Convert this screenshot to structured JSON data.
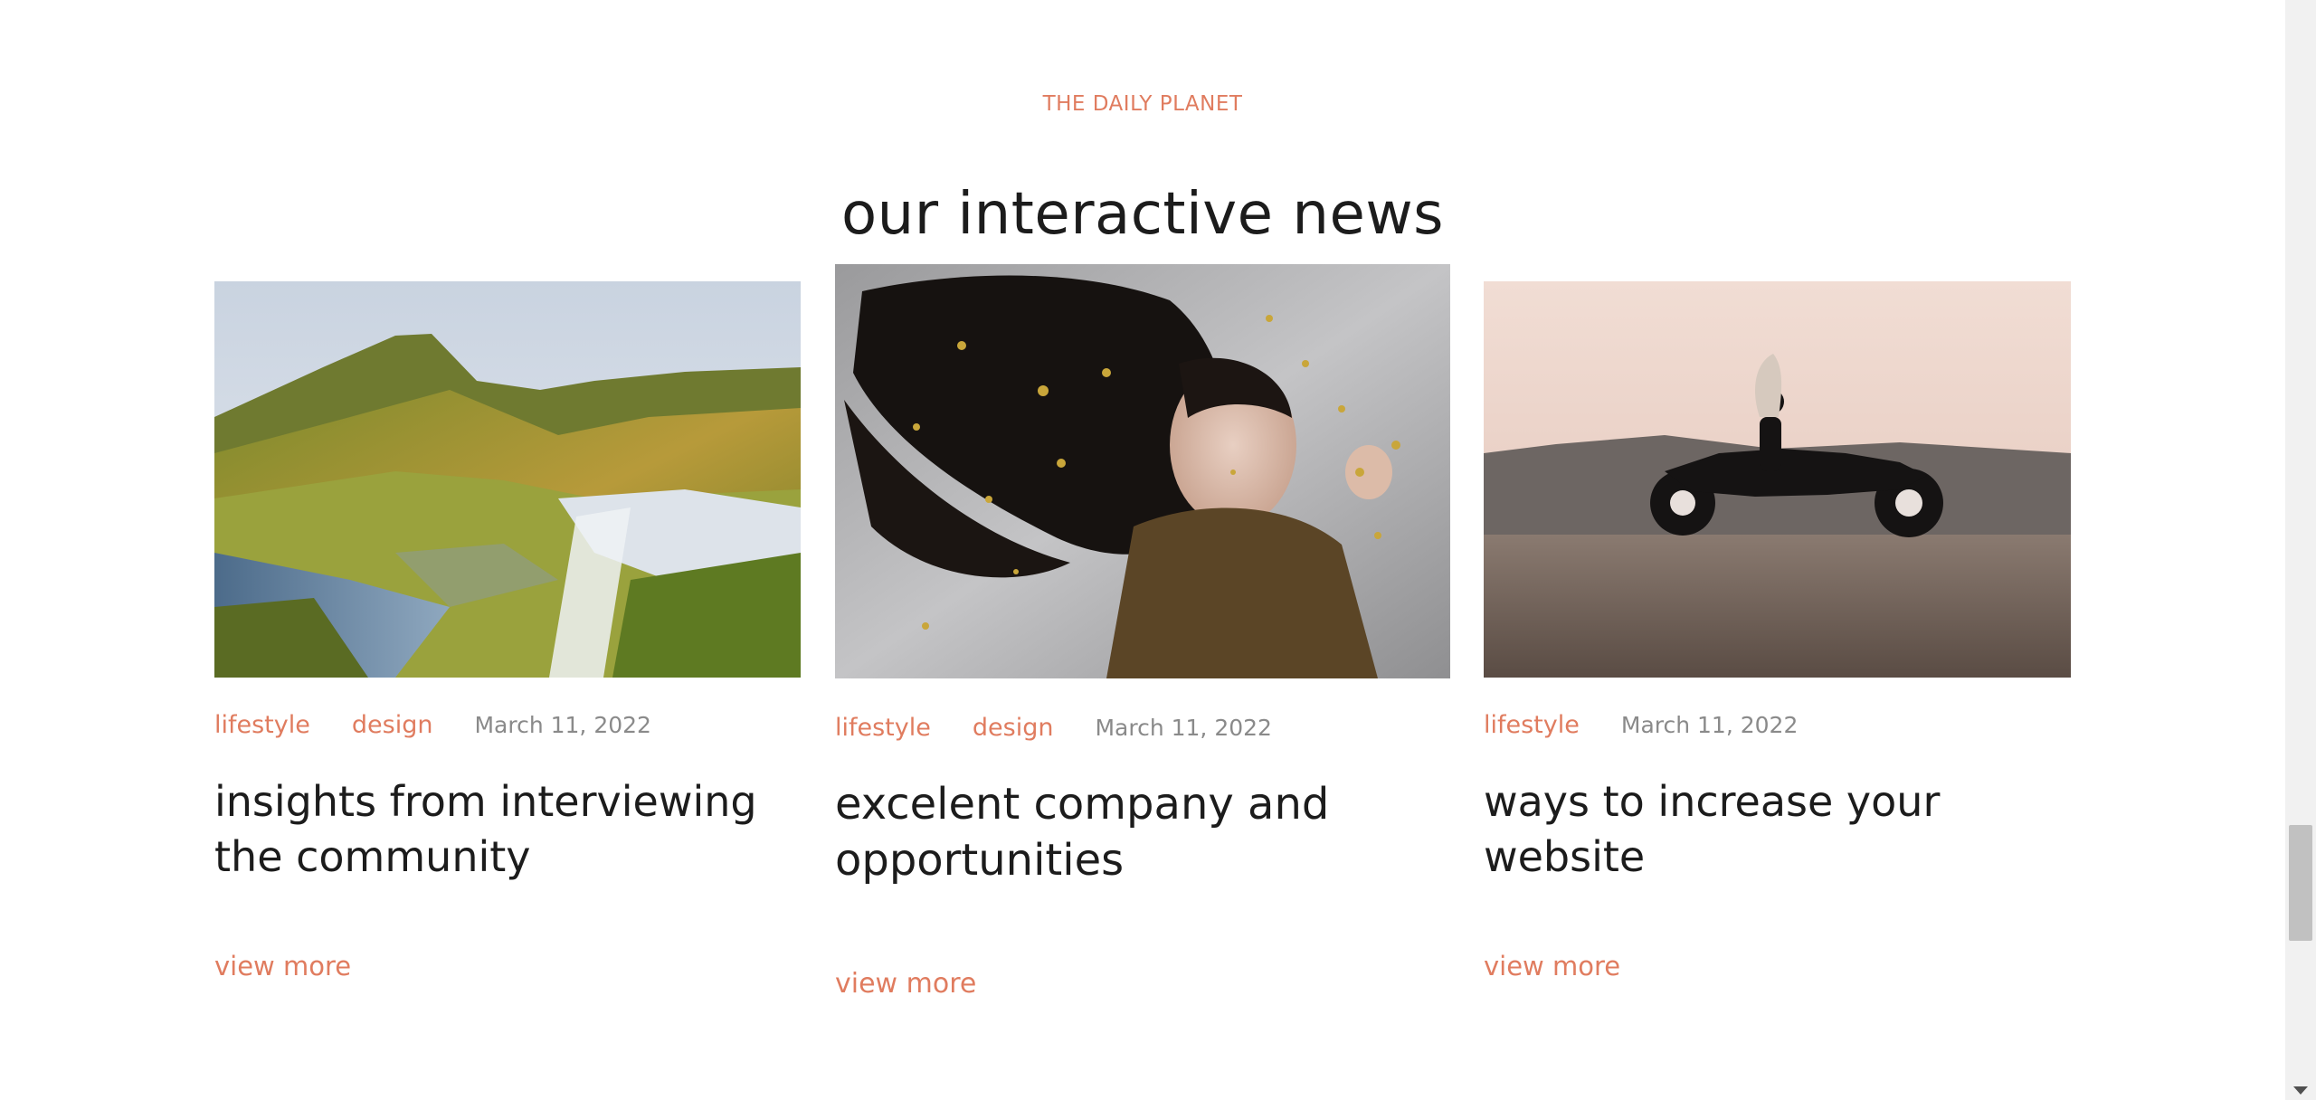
{
  "section": {
    "eyebrow": "THE DAILY PLANET",
    "title": "our interactive news"
  },
  "cards": [
    {
      "image": "mountain-waterfall-landscape",
      "tags": [
        "lifestyle",
        "design"
      ],
      "date": "March 11, 2022",
      "title": "insights from interviewing the community",
      "link": "view more"
    },
    {
      "image": "woman-lying-with-star-confetti",
      "tags": [
        "lifestyle",
        "design"
      ],
      "date": "March 11, 2022",
      "title": "excelent company and opportunities",
      "link": "view more"
    },
    {
      "image": "woman-on-motorcycle-sunset",
      "tags": [
        "lifestyle"
      ],
      "date": "March 11, 2022",
      "title": "ways to increase your website",
      "link": "view more"
    }
  ],
  "colors": {
    "accent": "#e07c5f",
    "text": "#1c1c1c",
    "muted": "#8a8a8a"
  }
}
